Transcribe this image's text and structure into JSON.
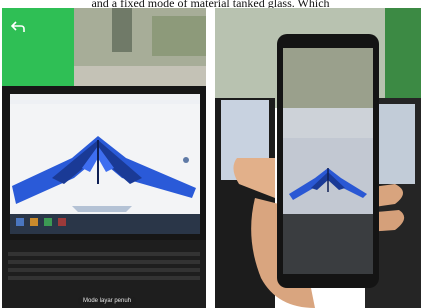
{
  "caption": "and a fixed mode of material tanked glass. Which",
  "left_photo": {
    "back_icon": "back-arrow-icon",
    "mode_label": "Mode layar penuh"
  },
  "right_photo": {}
}
